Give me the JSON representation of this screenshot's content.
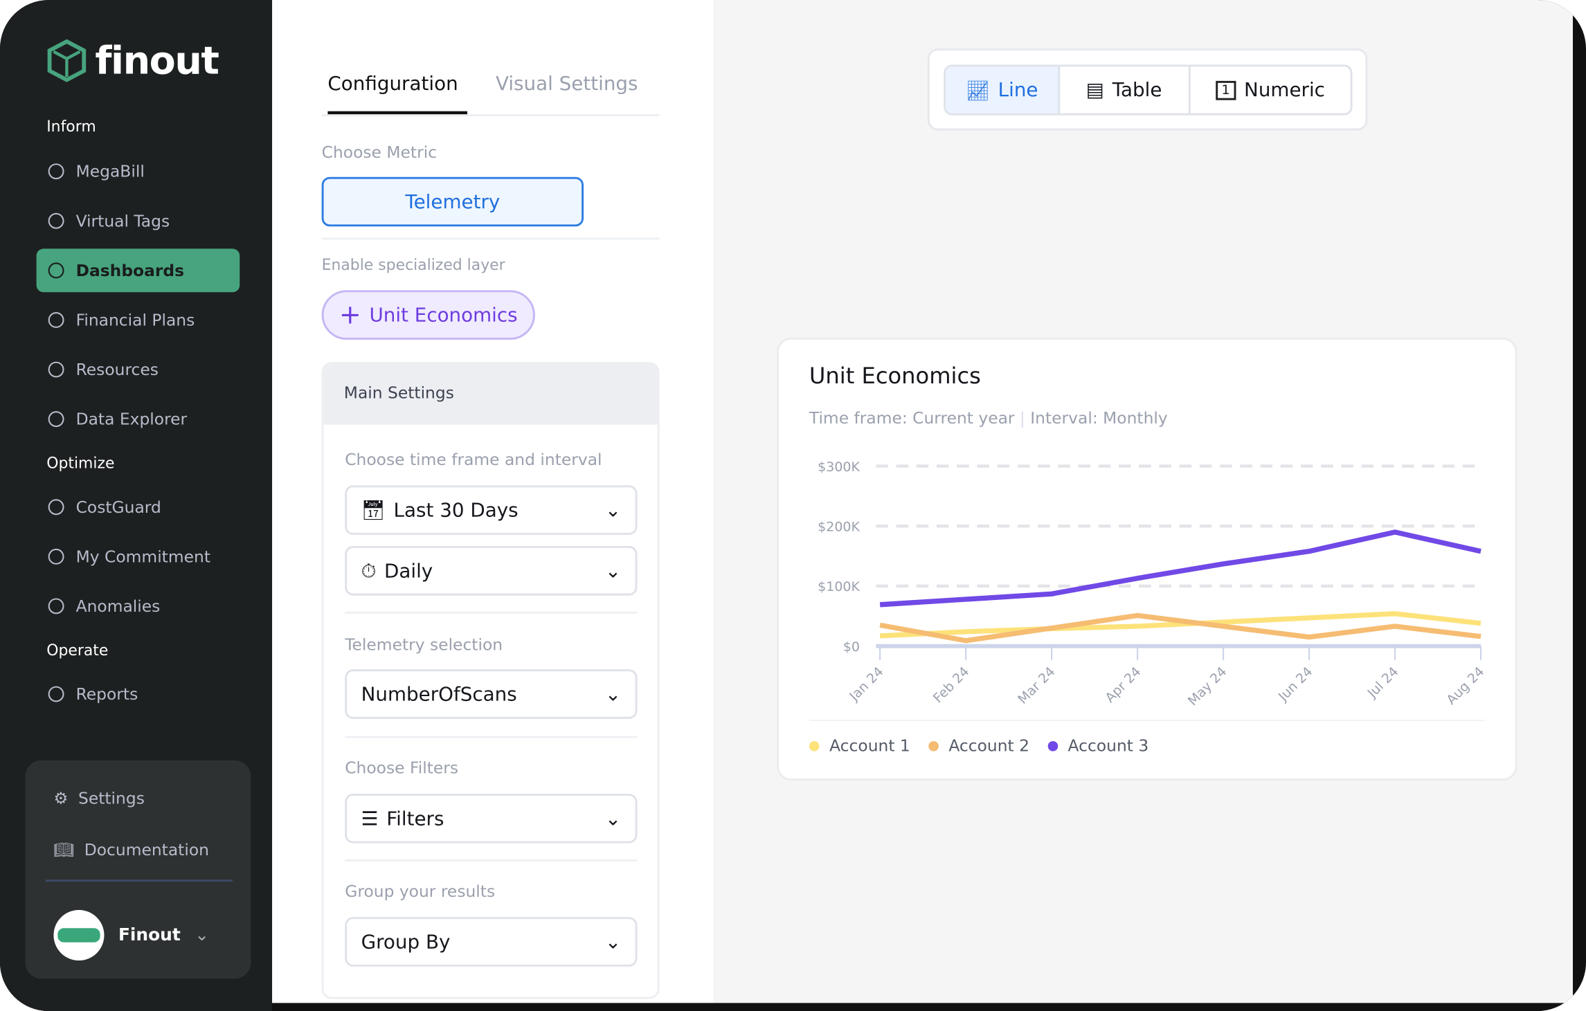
{
  "brand": {
    "name": "finout",
    "accent": "#47a47e"
  },
  "sidebar": {
    "sections": [
      {
        "label": "Inform",
        "items": [
          {
            "label": "MegaBill",
            "icon": "dollar-circle-icon"
          },
          {
            "label": "Virtual Tags",
            "icon": "tag-icon"
          },
          {
            "label": "Dashboards",
            "icon": "grid-icon",
            "active": true
          },
          {
            "label": "Financial Plans",
            "icon": "pie-icon"
          },
          {
            "label": "Resources",
            "icon": "table-icon"
          },
          {
            "label": "Data Explorer",
            "icon": "compass-icon"
          }
        ]
      },
      {
        "label": "Optimize",
        "items": [
          {
            "label": "CostGuard",
            "icon": "shield-check-icon"
          },
          {
            "label": "My Commitment",
            "icon": "wallet-icon"
          },
          {
            "label": "Anomalies",
            "icon": "pulse-icon"
          }
        ]
      },
      {
        "label": "Operate",
        "items": [
          {
            "label": "Reports",
            "icon": "clipboard-icon"
          }
        ]
      }
    ],
    "bottom": {
      "settings": "Settings",
      "documentation": "Documentation",
      "user": "Finout"
    }
  },
  "config": {
    "tabs": [
      "Configuration",
      "Visual Settings"
    ],
    "choose_metric": "Choose Metric",
    "metric": "Telemetry",
    "specialized": "Enable specialized layer",
    "unit_button": "Unit Economics",
    "main_settings": "Main Settings",
    "time_label": "Choose time frame and interval",
    "time_frame": "Last 30 Days",
    "interval": "Daily",
    "telemetry_label": "Telemetry selection",
    "telemetry_value": "NumberOfScans",
    "filters_label": "Choose Filters",
    "filters_value": "Filters",
    "group_label": "Group your results",
    "group_value": "Group By"
  },
  "view_toggle": {
    "options": [
      "Line",
      "Table",
      "Numeric"
    ],
    "selected": "Line"
  },
  "card": {
    "title": "Unit Economics",
    "timeframe": "Time frame: Current year",
    "interval": "Interval: Monthly"
  },
  "chart_data": {
    "type": "line",
    "title": "Unit Economics",
    "categories": [
      "Jan 24",
      "Feb 24",
      "Mar 24",
      "Apr 24",
      "May 24",
      "Jun 24",
      "Jul 24",
      "Aug 24"
    ],
    "yticks": [
      "$0",
      "$100K",
      "$200K",
      "$300K"
    ],
    "ylim": [
      0,
      300000
    ],
    "grid": true,
    "legend_position": "bottom-left",
    "series": [
      {
        "name": "Account 1",
        "color": "#fde27a",
        "values": [
          17000,
          24000,
          29000,
          33000,
          40000,
          47000,
          54000,
          38000
        ]
      },
      {
        "name": "Account 2",
        "color": "#f5bc72",
        "values": [
          35000,
          9000,
          30000,
          51000,
          33000,
          15000,
          33000,
          16000
        ]
      },
      {
        "name": "Account 3",
        "color": "#7049e6",
        "values": [
          69000,
          78000,
          87000,
          113000,
          137000,
          158000,
          190000,
          158000
        ]
      }
    ]
  }
}
